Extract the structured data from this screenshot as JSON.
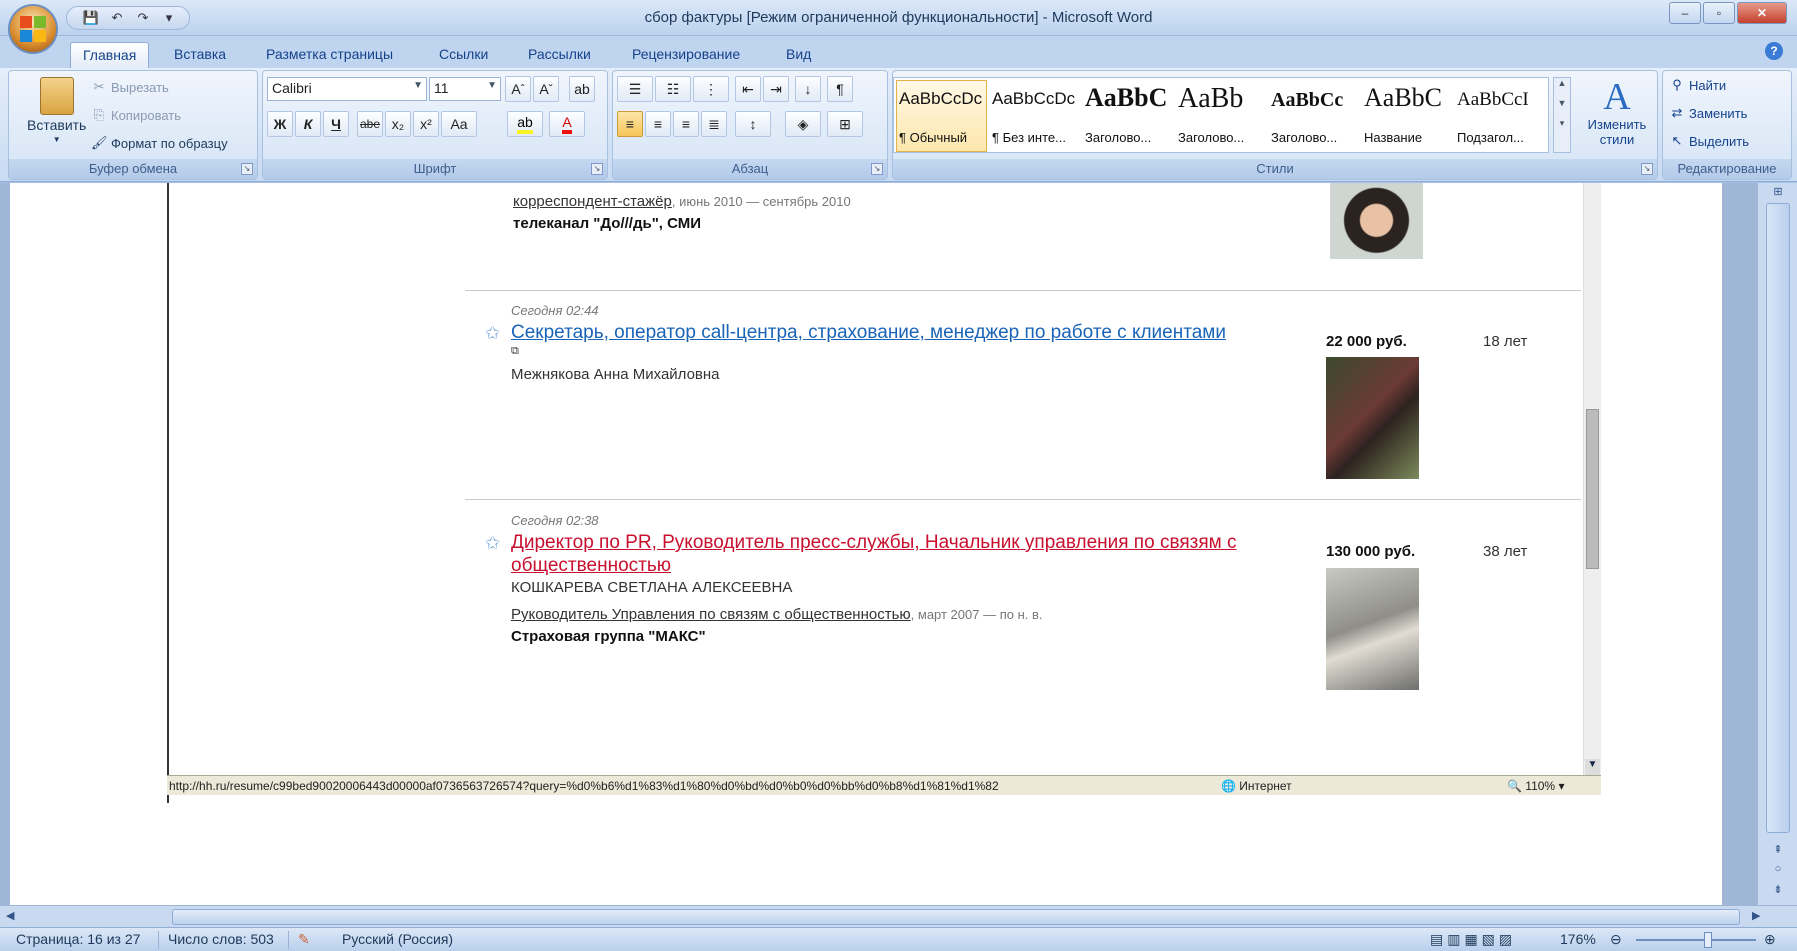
{
  "window": {
    "title": "сбор фактуры [Режим ограниченной функциональности] - Microsoft Word",
    "minimize": "–",
    "maximize": "▫",
    "close": "✕"
  },
  "qat": {
    "save_icon": "💾",
    "undo_icon": "↶",
    "redo_icon": "↷",
    "more_icon": "▾"
  },
  "tabs": [
    "Главная",
    "Вставка",
    "Разметка страницы",
    "Ссылки",
    "Рассылки",
    "Рецензирование",
    "Вид"
  ],
  "ribbon": {
    "clipboard": {
      "label": "Буфер обмена",
      "paste": "Вставить",
      "cut": "Вырезать",
      "copy": "Копировать",
      "format_painter": "Формат по образцу"
    },
    "font": {
      "label": "Шрифт",
      "font_name": "Calibri",
      "font_size": "11",
      "bold": "Ж",
      "italic": "К",
      "underline": "Ч",
      "strike": "abe",
      "subscript": "x₂",
      "superscript": "x²",
      "change_case": "Aa"
    },
    "paragraph": {
      "label": "Абзац"
    },
    "styles": {
      "label": "Стили",
      "items": [
        {
          "preview": "AaBbCcDc",
          "name": "¶ Обычный"
        },
        {
          "preview": "AaBbCcDc",
          "name": "¶ Без инте..."
        },
        {
          "preview": "AaBbC",
          "name": "Заголово..."
        },
        {
          "preview": "AaBb",
          "name": "Заголово..."
        },
        {
          "preview": "AaBbCc",
          "name": "Заголово..."
        },
        {
          "preview": "AaBbC",
          "name": "Название"
        },
        {
          "preview": "AaBbCcI",
          "name": "Подзагол..."
        }
      ],
      "change_styles": "Изменить стили"
    },
    "editing": {
      "label": "Редактирование",
      "find": "Найти",
      "replace": "Заменить",
      "select": "Выделить"
    }
  },
  "document": {
    "resume0": {
      "job": "корреспондент-стажёр",
      "period": ", июнь 2010 — сентябрь 2010",
      "company": "телеканал \"До///дь\", СМИ"
    },
    "resume1": {
      "date": "Сегодня 02:44",
      "title": "Секретарь, оператор call-центра, страхование, менеджер по работе с клиентами",
      "name": "Межнякова Анна Михайловна",
      "salary": "22 000 руб.",
      "age": "18 лет"
    },
    "resume2": {
      "date": "Сегодня 02:38",
      "title": "Директор по PR, Руководитель пресс-службы, Начальник управления по связям с общественностью",
      "name": "КОШКАРЕВА СВЕТЛАНА АЛЕКСЕЕВНА",
      "job": "Руководитель Управления по связям с общественностью",
      "period": ", март 2007 — по н. в.",
      "company": "Страховая группа \"МАКС\"",
      "salary": "130 000 руб.",
      "age": "38 лет"
    },
    "browser_status": {
      "url": "http://hh.ru/resume/c99bed90020006443d00000af0736563726574?query=%d0%b6%d1%83%d1%80%d0%bd%d0%b0%d0%bb%d0%b8%d1%81%d1%82",
      "zone": "Интернет",
      "zoom": "110%"
    }
  },
  "statusbar": {
    "page": "Страница: 16 из 27",
    "words": "Число слов: 503",
    "language": "Русский (Россия)",
    "zoom": "176%"
  }
}
